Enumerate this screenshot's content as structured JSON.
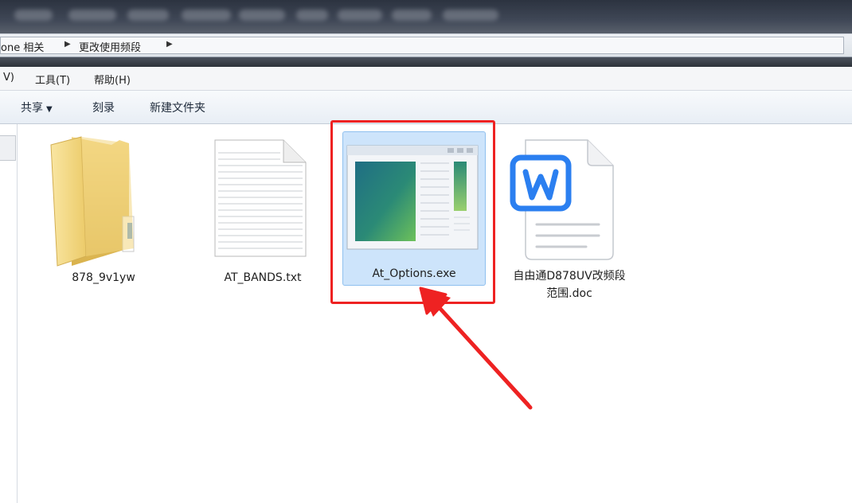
{
  "address": {
    "crumbs": [
      "one 相关",
      "更改使用频段"
    ]
  },
  "menu": {
    "items": [
      "V)",
      "工具(T)",
      "帮助(H)"
    ]
  },
  "toolbar": {
    "share_label": "共享",
    "burn_label": "刻录",
    "new_folder_label": "新建文件夹"
  },
  "files": [
    {
      "name": "878_9v1yw",
      "type": "folder",
      "icon": "folder-icon"
    },
    {
      "name": "AT_BANDS.txt",
      "type": "text",
      "icon": "text-file-icon"
    },
    {
      "name": "At_Options.exe",
      "type": "application",
      "icon": "exe-window-icon",
      "selected": true
    },
    {
      "name_line1": "自由通D878UV改频段",
      "name_line2": "范围.doc",
      "type": "word",
      "icon": "word-doc-icon"
    }
  ],
  "colors": {
    "selection": "#cde4fb",
    "highlight": "#ee2222",
    "word_blue": "#2b7ff0"
  }
}
